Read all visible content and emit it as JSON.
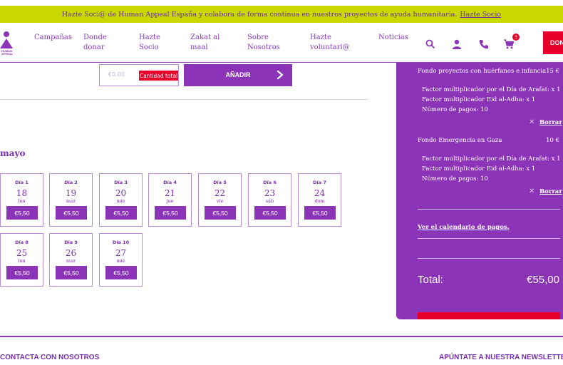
{
  "banner": {
    "text": "Hazte Soci@ de Human Appeal España y colabora de forma continua en nuestros proyectos de ayuda humanitaria.",
    "link": "Hazte Socio"
  },
  "header": {
    "logo_text": "HUMAN APPEAL",
    "nav": [
      {
        "line1": "Campañas",
        "line2": ""
      },
      {
        "line1": "Donde",
        "line2": "donar"
      },
      {
        "line1": "Hazte",
        "line2": "Socio"
      },
      {
        "line1": "Zakat al",
        "line2": "maal"
      },
      {
        "line1": "Sobre",
        "line2": "Nosotros"
      },
      {
        "line1": "Hazte",
        "line2": "voluntari@"
      },
      {
        "line1": "Noticias",
        "line2": ""
      }
    ],
    "cart_count": "3",
    "donate_label": "DON"
  },
  "form": {
    "amount_placeholder": "€0.00",
    "amount_badge": "Cantidad total",
    "add_label": "AÑADIR"
  },
  "calendar": {
    "month": "mayo",
    "days": [
      {
        "label": "Día 1",
        "num": "18",
        "wk": "lun",
        "price": "€5,50"
      },
      {
        "label": "Día 2",
        "num": "19",
        "wk": "mar",
        "price": "€5,50"
      },
      {
        "label": "Día 3",
        "num": "20",
        "wk": "mié",
        "price": "€5,50"
      },
      {
        "label": "Día 4",
        "num": "21",
        "wk": "jue",
        "price": "€5,50"
      },
      {
        "label": "Día 5",
        "num": "22",
        "wk": "vie",
        "price": "€5,50"
      },
      {
        "label": "Día 6",
        "num": "23",
        "wk": "sáb",
        "price": "€5,50"
      },
      {
        "label": "Día 7",
        "num": "24",
        "wk": "dom",
        "price": "€5,50"
      },
      {
        "label": "Día 8",
        "num": "25",
        "wk": "lun",
        "price": "€5,50"
      },
      {
        "label": "Día 9",
        "num": "26",
        "wk": "mar",
        "price": "€5,50"
      },
      {
        "label": "Día 10",
        "num": "27",
        "wk": "mié",
        "price": "€5,50"
      }
    ]
  },
  "summary": {
    "items": [
      {
        "name": "Fondo proyectos con huérfanos e infancia",
        "amount": "15 €",
        "details": [
          "Factor multiplicador por el Día de Arafat: x 1",
          "Factor multiplicador Eid al-Adha: x 1",
          "Número de pagos: 10"
        ],
        "delete": "Borrar"
      },
      {
        "name": "Fondo Emergencia en Gaza",
        "amount": "10 €",
        "details": [
          "Factor multiplicador por el Día de Arafat: x 1",
          "Factor multiplicador Eid al-Adha: x 1",
          "Número de pagos: 10"
        ],
        "delete": "Borrar"
      }
    ],
    "calendar_link": "Ver el calendario de pagos.",
    "total_label": "Total:",
    "total_value": "€55,00"
  },
  "footer": {
    "contact": "CONTACTA CON NOSOTROS",
    "newsletter": "APÚNTATE A NUESTRA NEWSLETTER"
  },
  "colors": {
    "primary": "#8c34b8",
    "accent": "#e8002b",
    "banner": "#c8d800"
  }
}
